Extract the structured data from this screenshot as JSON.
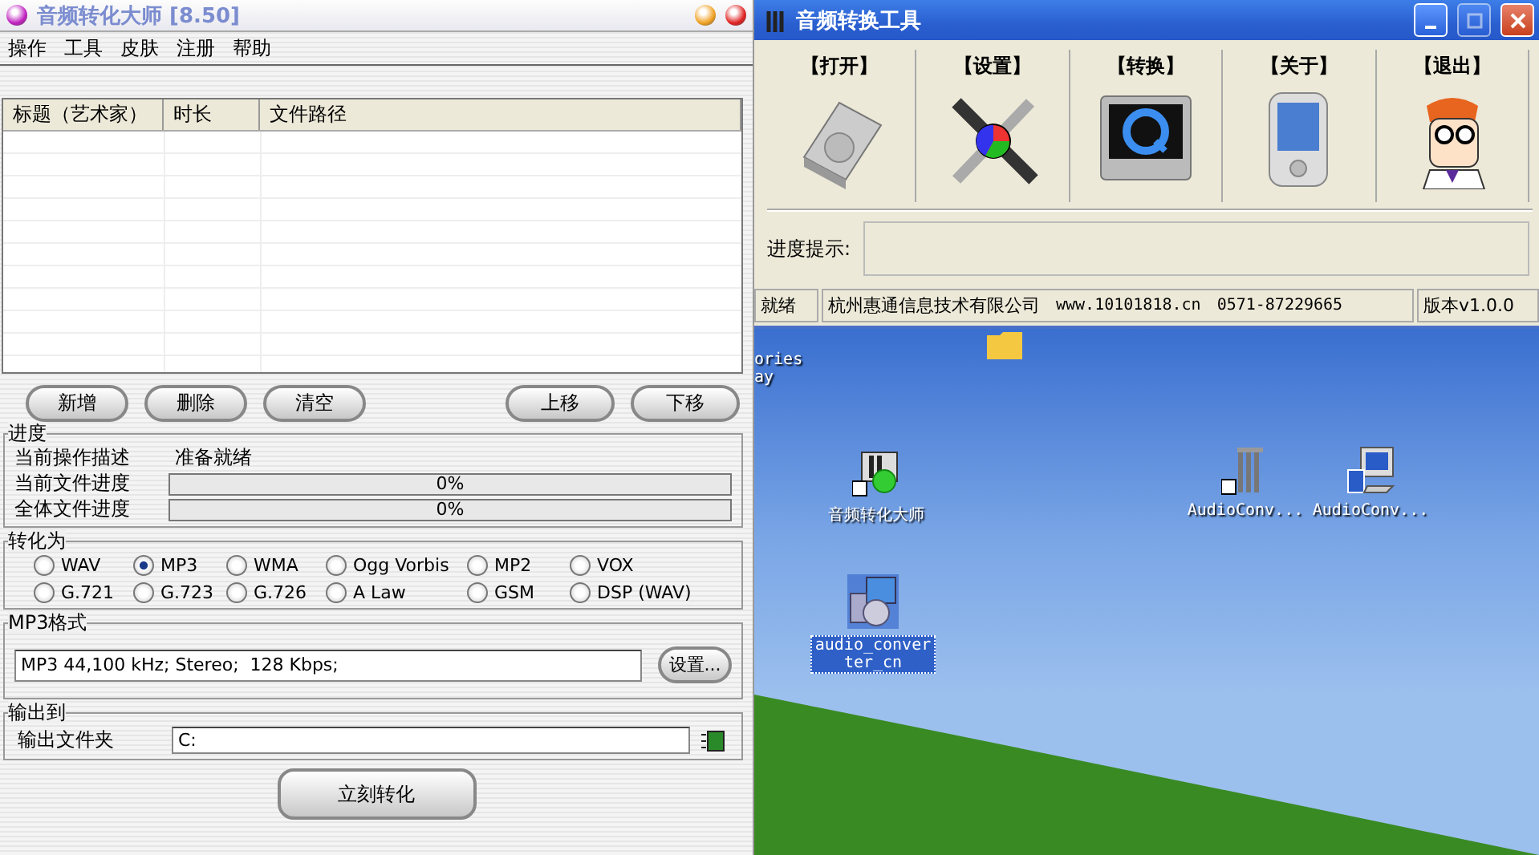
{
  "main_window": {
    "title": "音频转化大师 [8.50]",
    "menu": [
      "操作",
      "工具",
      "皮肤",
      "注册",
      "帮助"
    ],
    "table": {
      "columns": [
        "标题（艺术家）",
        "时长",
        "文件路径"
      ]
    },
    "list_buttons": [
      "新增",
      "删除",
      "清空"
    ],
    "move_buttons": [
      "上移",
      "下移"
    ],
    "progress": {
      "title": "进度",
      "rows": [
        {
          "kind": "text",
          "label": "当前操作描述",
          "value": "准备就绪"
        },
        {
          "kind": "bar",
          "label": "当前文件进度",
          "reading": "0%",
          "level": 0
        },
        {
          "kind": "bar",
          "label": "全体文件进度",
          "reading": "0%",
          "level": 0
        }
      ]
    },
    "convert_to": {
      "title": "转化为",
      "options": [
        {
          "label": "WAV",
          "selected": false
        },
        {
          "label": "MP3",
          "selected": true
        },
        {
          "label": "WMA",
          "selected": false
        },
        {
          "label": "Ogg Vorbis",
          "selected": false
        },
        {
          "label": "MP2",
          "selected": false
        },
        {
          "label": "VOX",
          "selected": false
        },
        {
          "label": "G.721",
          "selected": false
        },
        {
          "label": "G.723",
          "selected": false
        },
        {
          "label": "G.726",
          "selected": false
        },
        {
          "label": "A Law",
          "selected": false
        },
        {
          "label": "GSM",
          "selected": false
        },
        {
          "label": "DSP (WAV)",
          "selected": false
        }
      ]
    },
    "format": {
      "title": "MP3格式",
      "value": "MP3 44,100 kHz; Stereo;  128 Kbps;",
      "button": "设置..."
    },
    "output": {
      "title": "输出到",
      "label": "输出文件夹",
      "value": "C:"
    },
    "convert_button": "立刻转化"
  },
  "tool_window": {
    "title": "音频转换工具",
    "toolbar": [
      {
        "label": "【打开】",
        "kind": "drive"
      },
      {
        "label": "【设置】",
        "kind": "tools"
      },
      {
        "label": "【转换】",
        "kind": "player"
      },
      {
        "label": "【关于】",
        "kind": "pda"
      },
      {
        "label": "【退出】",
        "kind": "cartoon"
      }
    ],
    "progress_label": "进度提示:",
    "status_bar": {
      "state": "就绪",
      "company": "杭州惠通信息技术有限公司",
      "website": "www.10101818.cn",
      "phone": "0571-87229665",
      "version": "版本v1.0.0"
    }
  },
  "desktop": {
    "icons": [
      {
        "kind": "partial",
        "label": "ories ay",
        "selected": false
      },
      {
        "kind": "folder",
        "selected": false
      },
      {
        "kind": "converter",
        "label": "音频转化大师",
        "selected": false
      },
      {
        "kind": "bars",
        "label": "AudioConv...",
        "selected": false
      },
      {
        "kind": "computer",
        "label": "AudioConv...",
        "selected": false
      },
      {
        "kind": "installer",
        "label": "audio_converter_cn",
        "selected": true
      }
    ]
  }
}
